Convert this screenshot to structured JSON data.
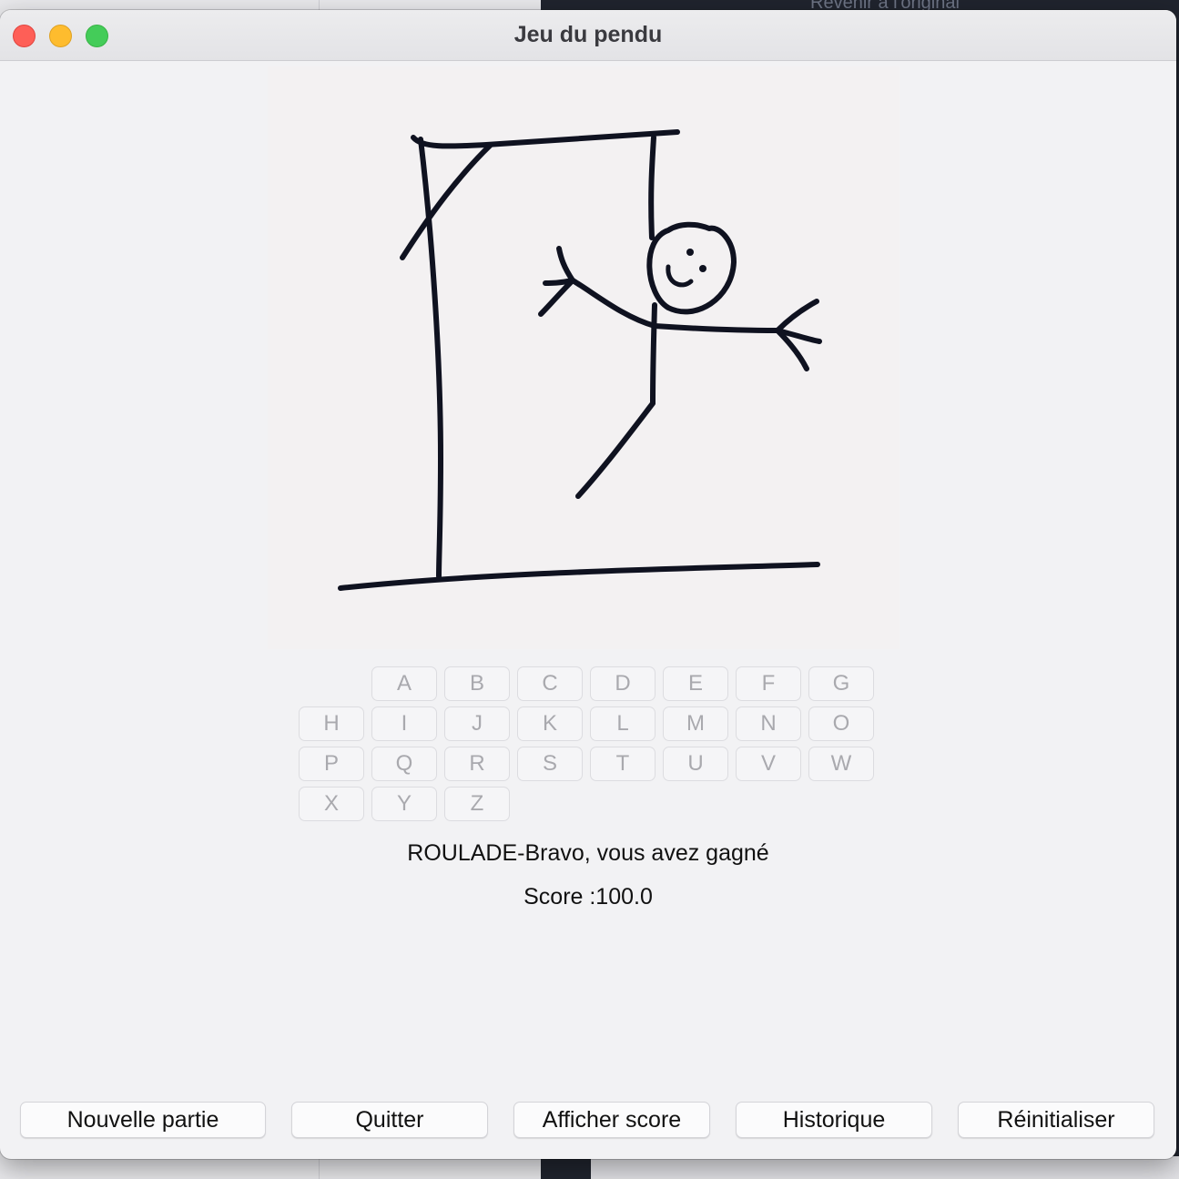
{
  "background": {
    "revert_label": "Revenir à l'original"
  },
  "window": {
    "title": "Jeu du pendu"
  },
  "keyboard": {
    "letters": [
      "A",
      "B",
      "C",
      "D",
      "E",
      "F",
      "G",
      "H",
      "I",
      "J",
      "K",
      "L",
      "M",
      "N",
      "O",
      "P",
      "Q",
      "R",
      "S",
      "T",
      "U",
      "V",
      "W",
      "X",
      "Y",
      "Z"
    ],
    "state": "disabled"
  },
  "status": {
    "message": "ROULADE-Bravo, vous avez gagné",
    "score": "Score :100.0"
  },
  "buttons": {
    "new_game": "Nouvelle partie",
    "quit": "Quitter",
    "show_score": "Afficher score",
    "history": "Historique",
    "reset": "Réinitialiser"
  },
  "colors": {
    "close": "#fe5f57",
    "minimize": "#febc2e",
    "maximize": "#28c840",
    "window_bg": "#f2f2f4",
    "ink": "#0f1220"
  },
  "icons": {
    "hangman": "hangman-drawing"
  }
}
